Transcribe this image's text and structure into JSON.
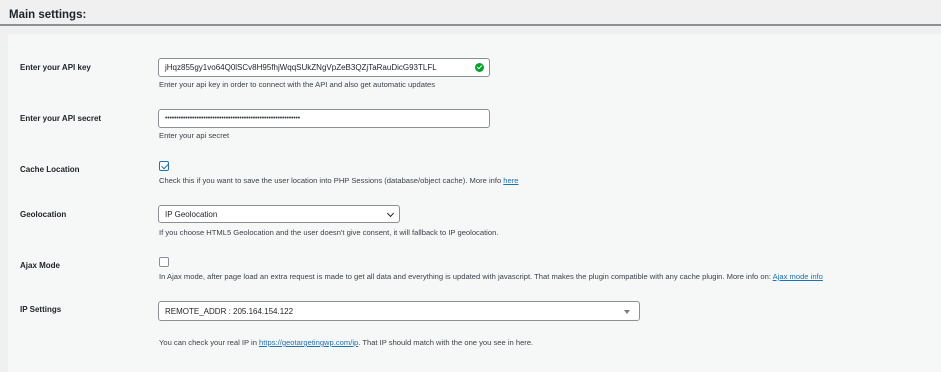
{
  "header": {
    "title": "Main settings:"
  },
  "api_key": {
    "label": "Enter your API key",
    "value": "jHqz855gy1vo64Q0lSCv8H95fhjWqqSUkZNgVpZeB3QZjTaRauDicG93TLFL",
    "description": "Enter your api key in order to connect with the API and also get automatic updates",
    "status_icon": "check-circle-icon",
    "status_color": "#00a32a"
  },
  "api_secret": {
    "label": "Enter your API secret",
    "value": "••••••••••••••••••••••••••••••••••••••••••••••••••••••••••••",
    "description": "Enter your api secret"
  },
  "cache_location": {
    "label": "Cache Location",
    "checked": true,
    "description": "Check this if you want to save the user location into PHP Sessions (database/object cache). More info ",
    "link_text": "here"
  },
  "geolocation": {
    "label": "Geolocation",
    "selected": "IP Geolocation",
    "description": "If you choose HTML5 Geolocation and the user doesn't give consent, it will fallback to IP geolocation."
  },
  "ajax_mode": {
    "label": "Ajax Mode",
    "checked": false,
    "description": "In Ajax mode, after page load an extra request is made to get all data and everything is updated with javascript. That makes the plugin compatible with any cache plugin. More info on: ",
    "link_text": "Ajax mode info"
  },
  "ip_settings": {
    "label": "IP Settings",
    "selected": "REMOTE_ADDR : 205.164.154.122",
    "description_pre": "You can check your real IP in ",
    "link_text": "https://geotargetingwp.com/ip",
    "description_post": ". That IP should match with the one you see in here."
  },
  "colors": {
    "link": "#2271b1",
    "accent": "#2271b1",
    "success": "#00a32a"
  }
}
